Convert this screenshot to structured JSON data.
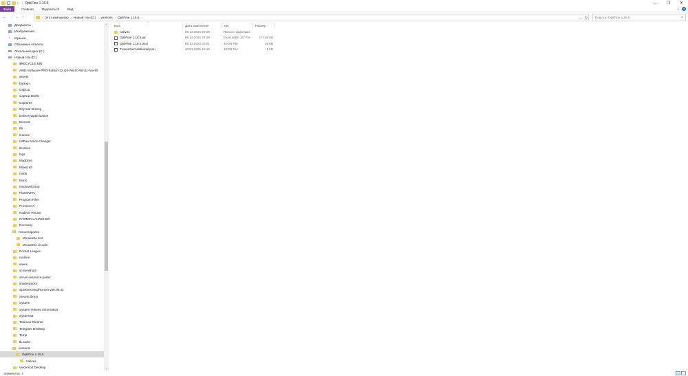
{
  "window": {
    "title": "OptiFine 1.16.5",
    "qa_label": "≡",
    "controls": {
      "minimize": "—",
      "maximize": "❐",
      "close": "✕"
    }
  },
  "ribbon": {
    "tabs": [
      "Файл",
      "Главная",
      "Поделиться",
      "Вид"
    ],
    "collapse_glyph": "⌄",
    "help_glyph": "?"
  },
  "nav_glyphs": {
    "back": "←",
    "forward": "→",
    "recent": "⌄",
    "up": "↑"
  },
  "address": {
    "segments": [
      "Этот компьютер",
      "Новый том (D:)",
      "versions",
      "OptiFine 1.16.5"
    ],
    "separator": "›",
    "dropdown_glyph": "⌄",
    "refresh_glyph": "↻"
  },
  "search": {
    "placeholder": "Поиск в: OptiFine 1.16.5",
    "icon_glyph": "⌕"
  },
  "columns": [
    "Имя",
    "Дата изменения",
    "Тип",
    "Размер"
  ],
  "sort_glyph": "^",
  "files": [
    {
      "name": "natives",
      "date": "06.12.2024 20:29",
      "type": "Папка с файлами",
      "size": "",
      "icon": "folder-icon"
    },
    {
      "name": "OptiFine 1.16.5.jar",
      "date": "06.12.2024 20:29",
      "type": "Executable Jar File",
      "size": "17 136 КБ",
      "icon": "jar-file-icon"
    },
    {
      "name": "OptiFine 1.16.5.json",
      "date": "06.12.2024 20:21",
      "type": "JSON File",
      "size": "39 КБ",
      "icon": "json-file-icon"
    },
    {
      "name": "TLauncherAdditional.json",
      "date": "20.01.2025 15:49",
      "type": "JSON File",
      "size": "1 КБ",
      "icon": "json-file-icon"
    }
  ],
  "navpane": {
    "items": [
      {
        "label": "Документы",
        "kind": "library"
      },
      {
        "label": "Изображения",
        "kind": "library"
      },
      {
        "label": "Музыка",
        "kind": "music"
      },
      {
        "label": "Объемные объекты",
        "kind": "library"
      },
      {
        "label": "Локальный диск (C:)",
        "kind": "drive"
      },
      {
        "label": "Новый том (D:)",
        "kind": "drive",
        "expanded": true
      },
      {
        "label": "$RECYCLE.BIN",
        "kind": "folder",
        "indent": 1
      },
      {
        "label": "AMD-Software-PRO-Edition-22.Q4-Win10-Win11-Nov15",
        "kind": "folder",
        "indent": 1
      },
      {
        "label": "assets",
        "kind": "folder",
        "indent": 1
      },
      {
        "label": "backup",
        "kind": "folder",
        "indent": 1
      },
      {
        "label": "CapCut",
        "kind": "folder",
        "indent": 1
      },
      {
        "label": "CapCut Drafts",
        "kind": "folder",
        "indent": 1
      },
      {
        "label": "Captures",
        "kind": "folder",
        "indent": 1
      },
      {
        "label": "City Car Driving",
        "kind": "folder",
        "indent": 1
      },
      {
        "label": "DeliveryOptimization",
        "kind": "folder",
        "indent": 1
      },
      {
        "label": "Discord",
        "kind": "folder",
        "indent": 1
      },
      {
        "label": "dp",
        "kind": "folder",
        "indent": 1
      },
      {
        "label": "Games",
        "kind": "folder",
        "indent": 1
      },
      {
        "label": "HitPaw Voice Changer",
        "kind": "folder",
        "indent": 1
      },
      {
        "label": "libraries",
        "kind": "folder",
        "indent": 1
      },
      {
        "label": "logs",
        "kind": "folder",
        "indent": 1
      },
      {
        "label": "MapData",
        "kind": "folder",
        "indent": 1
      },
      {
        "label": "Minecraft",
        "kind": "folder",
        "indent": 1
      },
      {
        "label": "mods",
        "kind": "folder",
        "indent": 1
      },
      {
        "label": "Mono",
        "kind": "folder",
        "indent": 1
      },
      {
        "label": "msdownld.tmp",
        "kind": "folder",
        "indent": 1
      },
      {
        "label": "PlanetVPN",
        "kind": "folder",
        "indent": 1
      },
      {
        "label": "Program Files",
        "kind": "folder",
        "indent": 1
      },
      {
        "label": "Province X",
        "kind": "folder",
        "indent": 1
      },
      {
        "label": "Radeon ReLive",
        "kind": "folder",
        "indent": 1
      },
      {
        "label": "RADMIR LAUNCHER",
        "kind": "folder",
        "indent": 1
      },
      {
        "label": "Recovery",
        "kind": "folder",
        "indent": 1
      },
      {
        "label": "resourcepacks",
        "kind": "folder",
        "indent": 1,
        "expanded": true
      },
      {
        "label": "Winaestro text",
        "kind": "folder",
        "indent": 2
      },
      {
        "label": "Winaestro visuals",
        "kind": "folder",
        "indent": 2
      },
      {
        "label": "Rocket League",
        "kind": "folder",
        "indent": 1
      },
      {
        "label": "runtime",
        "kind": "folder",
        "indent": 1
      },
      {
        "label": "saves",
        "kind": "folder",
        "indent": 1
      },
      {
        "label": "screenshots",
        "kind": "folder",
        "indent": 1
      },
      {
        "label": "server-resource-packs",
        "kind": "folder",
        "indent": 1
      },
      {
        "label": "shaderpacks",
        "kind": "folder",
        "indent": 1
      },
      {
        "label": "Spintires MudRunner v28.09.22",
        "kind": "folder",
        "indent": 1
      },
      {
        "label": "SteamLibrary",
        "kind": "folder",
        "indent": 1
      },
      {
        "label": "System",
        "kind": "folder",
        "indent": 1
      },
      {
        "label": "System Volume Information",
        "kind": "folder",
        "indent": 1
      },
      {
        "label": "System64",
        "kind": "folder",
        "indent": 1
      },
      {
        "label": "Telamon Cleaner",
        "kind": "folder",
        "indent": 1
      },
      {
        "label": "Telegram Desktop",
        "kind": "folder",
        "indent": 1
      },
      {
        "label": "Temp",
        "kind": "folder",
        "indent": 1
      },
      {
        "label": "tlLoader",
        "kind": "folder",
        "indent": 1
      },
      {
        "label": "versions",
        "kind": "folder",
        "indent": 1,
        "expanded": true
      },
      {
        "label": "OptiFine 1.16.5",
        "kind": "folder",
        "indent": 2,
        "selected": true,
        "expanded": true
      },
      {
        "label": "natives",
        "kind": "folder",
        "indent": 3
      },
      {
        "label": "Voicemod Desktop",
        "kind": "folder",
        "indent": 1
      }
    ]
  },
  "scroll_glyphs": {
    "up": "˄",
    "down": "˅"
  },
  "status": {
    "items_count": "Элементов: 4"
  },
  "colors": {
    "file_tab": "#7b3fa0",
    "folder": "#f2c94c",
    "selection": "#d9d9d9"
  }
}
